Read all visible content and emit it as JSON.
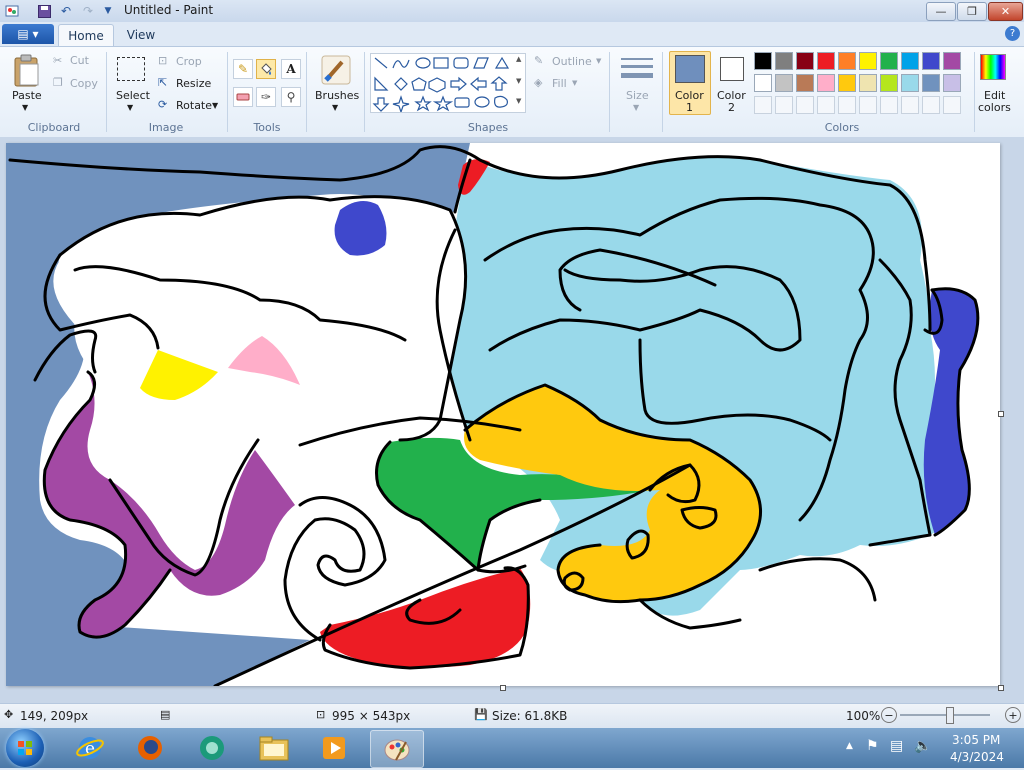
{
  "window": {
    "title": "Untitled - Paint",
    "buttons": {
      "minimize": "—",
      "maximize": "❐",
      "close": "✕"
    }
  },
  "tabs": {
    "home": "Home",
    "view": "View"
  },
  "ribbon": {
    "clipboard": {
      "label": "Clipboard",
      "paste": "Paste",
      "cut": "Cut",
      "copy": "Copy"
    },
    "image": {
      "label": "Image",
      "select": "Select",
      "crop": "Crop",
      "resize": "Resize",
      "rotate": "Rotate"
    },
    "tools": {
      "label": "Tools"
    },
    "brushes": {
      "label": "Brushes"
    },
    "shapes": {
      "label": "Shapes",
      "outline": "Outline",
      "fill": "Fill"
    },
    "size": {
      "label": "Size"
    },
    "color1": {
      "line1": "Color",
      "line2": "1",
      "value": "#6f8fbd"
    },
    "color2": {
      "line1": "Color",
      "line2": "2",
      "value": "#ffffff"
    },
    "colors": {
      "label": "Colors",
      "edit_line1": "Edit",
      "edit_line2": "colors"
    },
    "palette_row1": [
      "#000000",
      "#7f7f7f",
      "#880015",
      "#ed1c24",
      "#ff7f27",
      "#fff200",
      "#22b14c",
      "#00a2e8",
      "#3f48cc",
      "#a349a4"
    ],
    "palette_row2": [
      "#ffffff",
      "#c3c3c3",
      "#b97a57",
      "#ffaec9",
      "#ffc90e",
      "#efe4b0",
      "#b5e61d",
      "#99d9ea",
      "#7092be",
      "#c8bfe7"
    ]
  },
  "drawing": {
    "colors": {
      "bg_blue": "#7092be",
      "light_blue": "#99d9ea",
      "red": "#ed1c24",
      "blue": "#3f48cc",
      "yellow": "#fff200",
      "pink": "#ffaec9",
      "purple": "#a349a4",
      "green": "#22b14c",
      "orange": "#ffc90e"
    }
  },
  "status": {
    "cursor_pos": "149, 209px",
    "canvas_size": "995 × 543px",
    "file_size": "Size: 61.8KB",
    "zoom": "100%"
  },
  "taskbar": {
    "time": "3:05 PM",
    "date": "4/3/2024"
  }
}
